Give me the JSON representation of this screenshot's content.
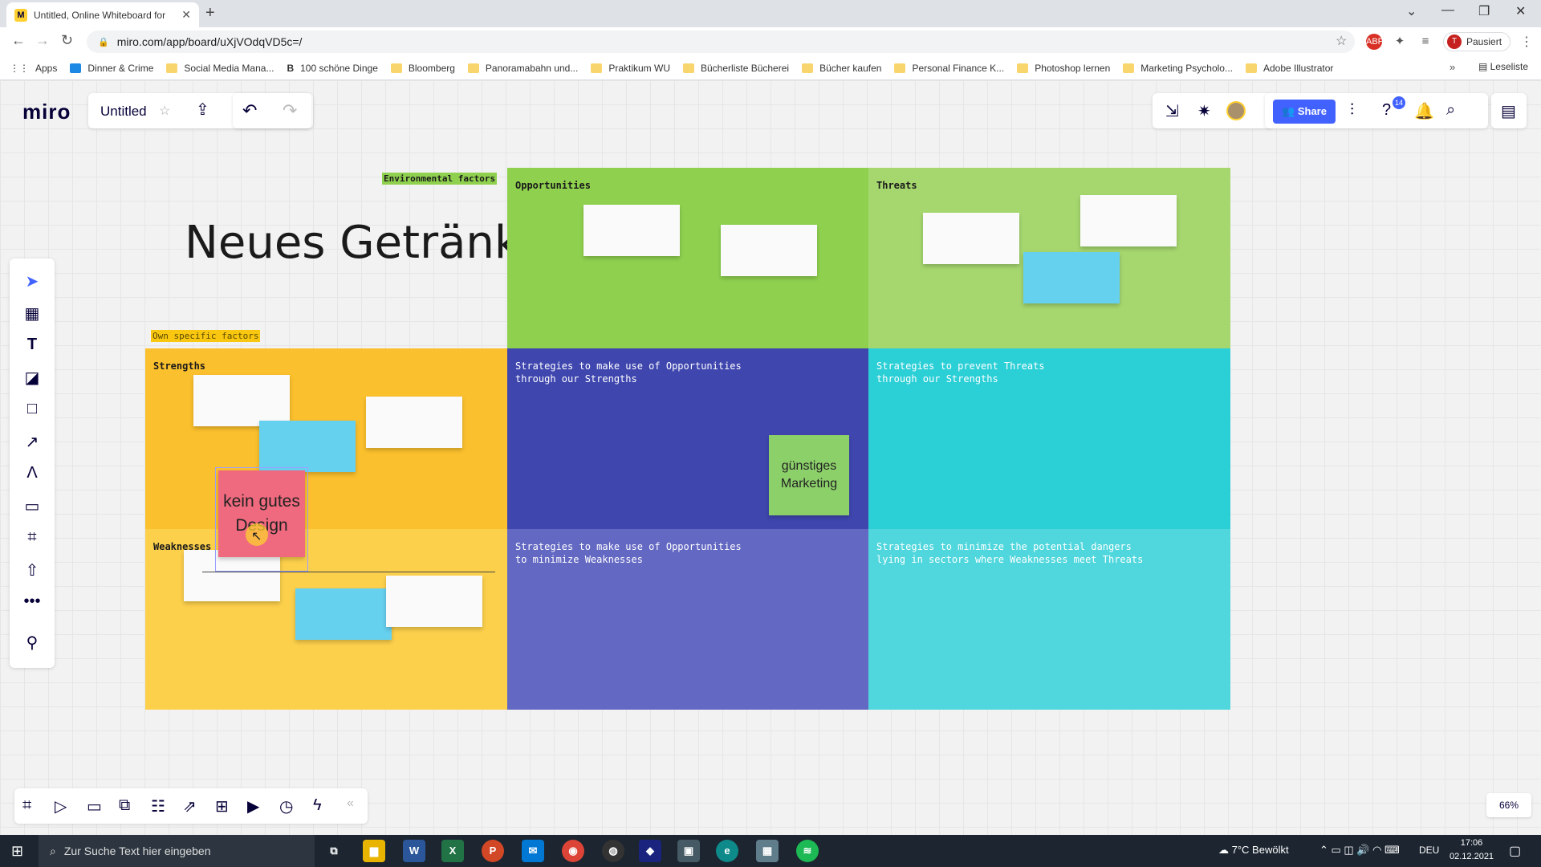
{
  "browser": {
    "tab_title": "Untitled, Online Whiteboard for",
    "url": "miro.com/app/board/uXjVOdqVD5c=/",
    "profile_status": "Pausiert",
    "profile_initial": "T",
    "bookmarks": [
      "Apps",
      "Dinner & Crime",
      "Social Media Mana...",
      "100 schöne Dinge",
      "Bloomberg",
      "Panoramabahn und...",
      "Praktikum WU",
      "Bücherliste Bücherei",
      "Bücher kaufen",
      "Personal Finance K...",
      "Photoshop lernen",
      "Marketing Psycholo...",
      "Adobe Illustrator"
    ],
    "reading_list": "Leseliste"
  },
  "miro": {
    "logo": "miro",
    "board_name": "Untitled",
    "share_label": "Share",
    "help_badge": "14",
    "zoom": "66%"
  },
  "board": {
    "title": "Neues Getränk",
    "env_label": "Environmental factors",
    "own_label": "Own specific factors",
    "quadrants": {
      "opportunities": "Opportunities",
      "threats": "Threats",
      "strengths": "Strengths",
      "so": "Strategies to make use of Opportunities\nthrough our Strengths",
      "st": "Strategies to prevent Threats\nthrough our Strengths",
      "weaknesses": "Weaknesses",
      "wo": "Strategies to make use of Opportunities\nto minimize Weaknesses",
      "wt": "Strategies to minimize the potential dangers\nlying in sectors where Weaknesses meet Threats"
    },
    "notes": {
      "green": "günstiges Marketing",
      "pink": "kein gutes Design"
    }
  },
  "taskbar": {
    "search_placeholder": "Zur Suche Text hier eingeben",
    "weather": "7°C  Bewölkt",
    "language": "DEU",
    "time": "17:06",
    "date": "02.12.2021"
  }
}
